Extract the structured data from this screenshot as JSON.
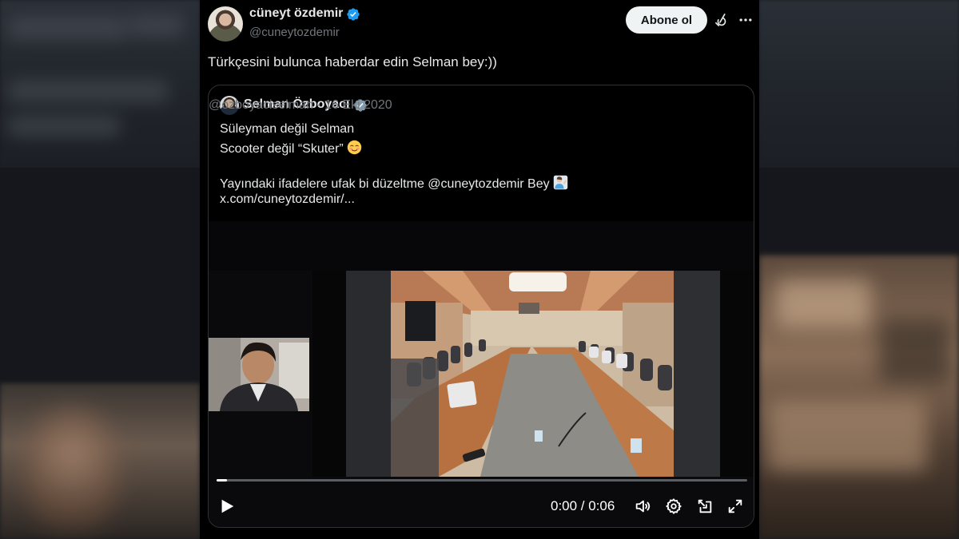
{
  "post": {
    "author": {
      "display_name": "cüneyt özdemir",
      "handle": "@cuneytozdemir",
      "verified": true
    },
    "follow_label": "Abone ol",
    "text": "Türkçesini bulunca haberdar edin Selman bey:))"
  },
  "quote": {
    "author": {
      "display_name": "Selman Özboyacı",
      "handle": "@ozboyaciselman",
      "verified": true
    },
    "meta": "@ozboyaciselman · 16 Eki 2020",
    "lines": [
      "Süleyman değil Selman",
      "Scooter değil “Skuter”",
      "Yayındaki ifadelere ufak bi düzeltme @cuneytozdemir Bey",
      "x.com/cuneytozdemir/..."
    ]
  },
  "video": {
    "time_label": "0:00 / 0:06",
    "progress": 0.01,
    "controls": [
      "play-icon",
      "volume-icon",
      "settings-icon",
      "pip-icon",
      "fullscreen-icon"
    ]
  },
  "colors": {
    "verified": "#1d9bf0",
    "quote_verified": "#829aab",
    "muted_text": "#71767b",
    "border": "#2f3336",
    "follow_bg": "#eff3f4"
  }
}
